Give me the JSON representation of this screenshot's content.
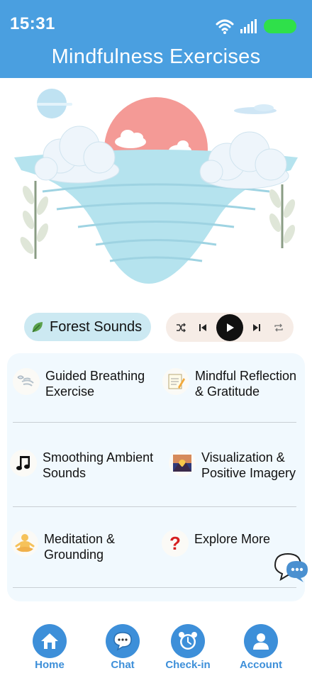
{
  "status": {
    "time": "15:31"
  },
  "header": {
    "title": "Mindfulness Exercises"
  },
  "player": {
    "track_label": "Forest Sounds"
  },
  "exercises": [
    {
      "label": "Guided Breathing Exercise",
      "icon": "breath-icon"
    },
    {
      "label": "Mindful Reflection & Gratitude",
      "icon": "memo-icon"
    },
    {
      "label": "Smoothing Ambient Sounds",
      "icon": "music-note-icon"
    },
    {
      "label": "Visualization & Positive Imagery",
      "icon": "sunrise-picture-icon"
    },
    {
      "label": "Meditation & Grounding",
      "icon": "meditation-person-icon"
    },
    {
      "label": "Explore More",
      "icon": "question-mark-icon"
    }
  ],
  "nav": {
    "home": "Home",
    "chat": "Chat",
    "checkin": "Check-in",
    "account": "Account"
  },
  "colors": {
    "header_bg": "#4a9fe0",
    "accent": "#3d8fd9",
    "battery": "#2fe04a",
    "chip_bg": "#cce9f2",
    "player_bg": "#f6ece6",
    "card_bg": "#f1f9fe"
  }
}
